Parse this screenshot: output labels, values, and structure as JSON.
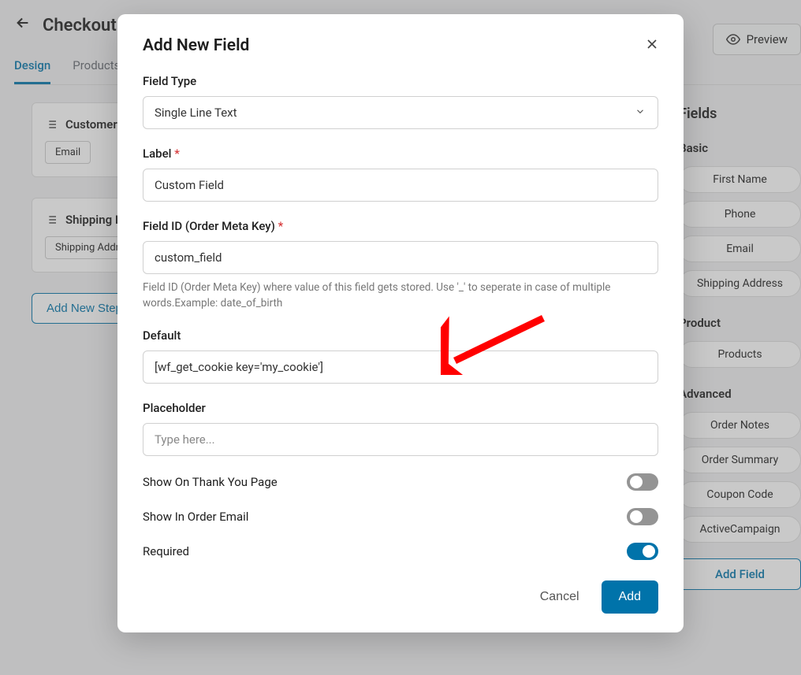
{
  "page": {
    "title": "Checkout",
    "preview": "Preview",
    "tabs": {
      "design": "Design",
      "products": "Products"
    },
    "sections": {
      "customer": "Customer Info",
      "shipping": "Shipping Info"
    },
    "tags": {
      "email": "Email",
      "shipping_addr": "Shipping Address"
    },
    "add_step": "Add New Step"
  },
  "sidebar": {
    "fields": "Fields",
    "basic": "Basic",
    "basic_items": [
      "First Name",
      "Phone",
      "Email",
      "Shipping Address"
    ],
    "product": "Product",
    "product_items": [
      "Products"
    ],
    "advanced": "Advanced",
    "advanced_items": [
      "Order Notes",
      "Order Summary",
      "Coupon Code",
      "ActiveCampaign"
    ],
    "add": "Add Field"
  },
  "modal": {
    "title": "Add New Field",
    "field_type_label": "Field Type",
    "field_type_value": "Single Line Text",
    "label_label": "Label",
    "label_value": "Custom Field",
    "field_id_label": "Field ID (Order Meta Key)",
    "field_id_value": "custom_field",
    "field_id_help": "Field ID (Order Meta Key) where value of this field gets stored. Use '_' to seperate in case of multiple words.Example: date_of_birth",
    "default_label": "Default",
    "default_value": "[wf_get_cookie key='my_cookie']",
    "placeholder_label": "Placeholder",
    "placeholder_placeholder": "Type here...",
    "show_thank_you": "Show On Thank You Page",
    "show_email": "Show In Order Email",
    "required": "Required",
    "cancel": "Cancel",
    "add": "Add"
  }
}
